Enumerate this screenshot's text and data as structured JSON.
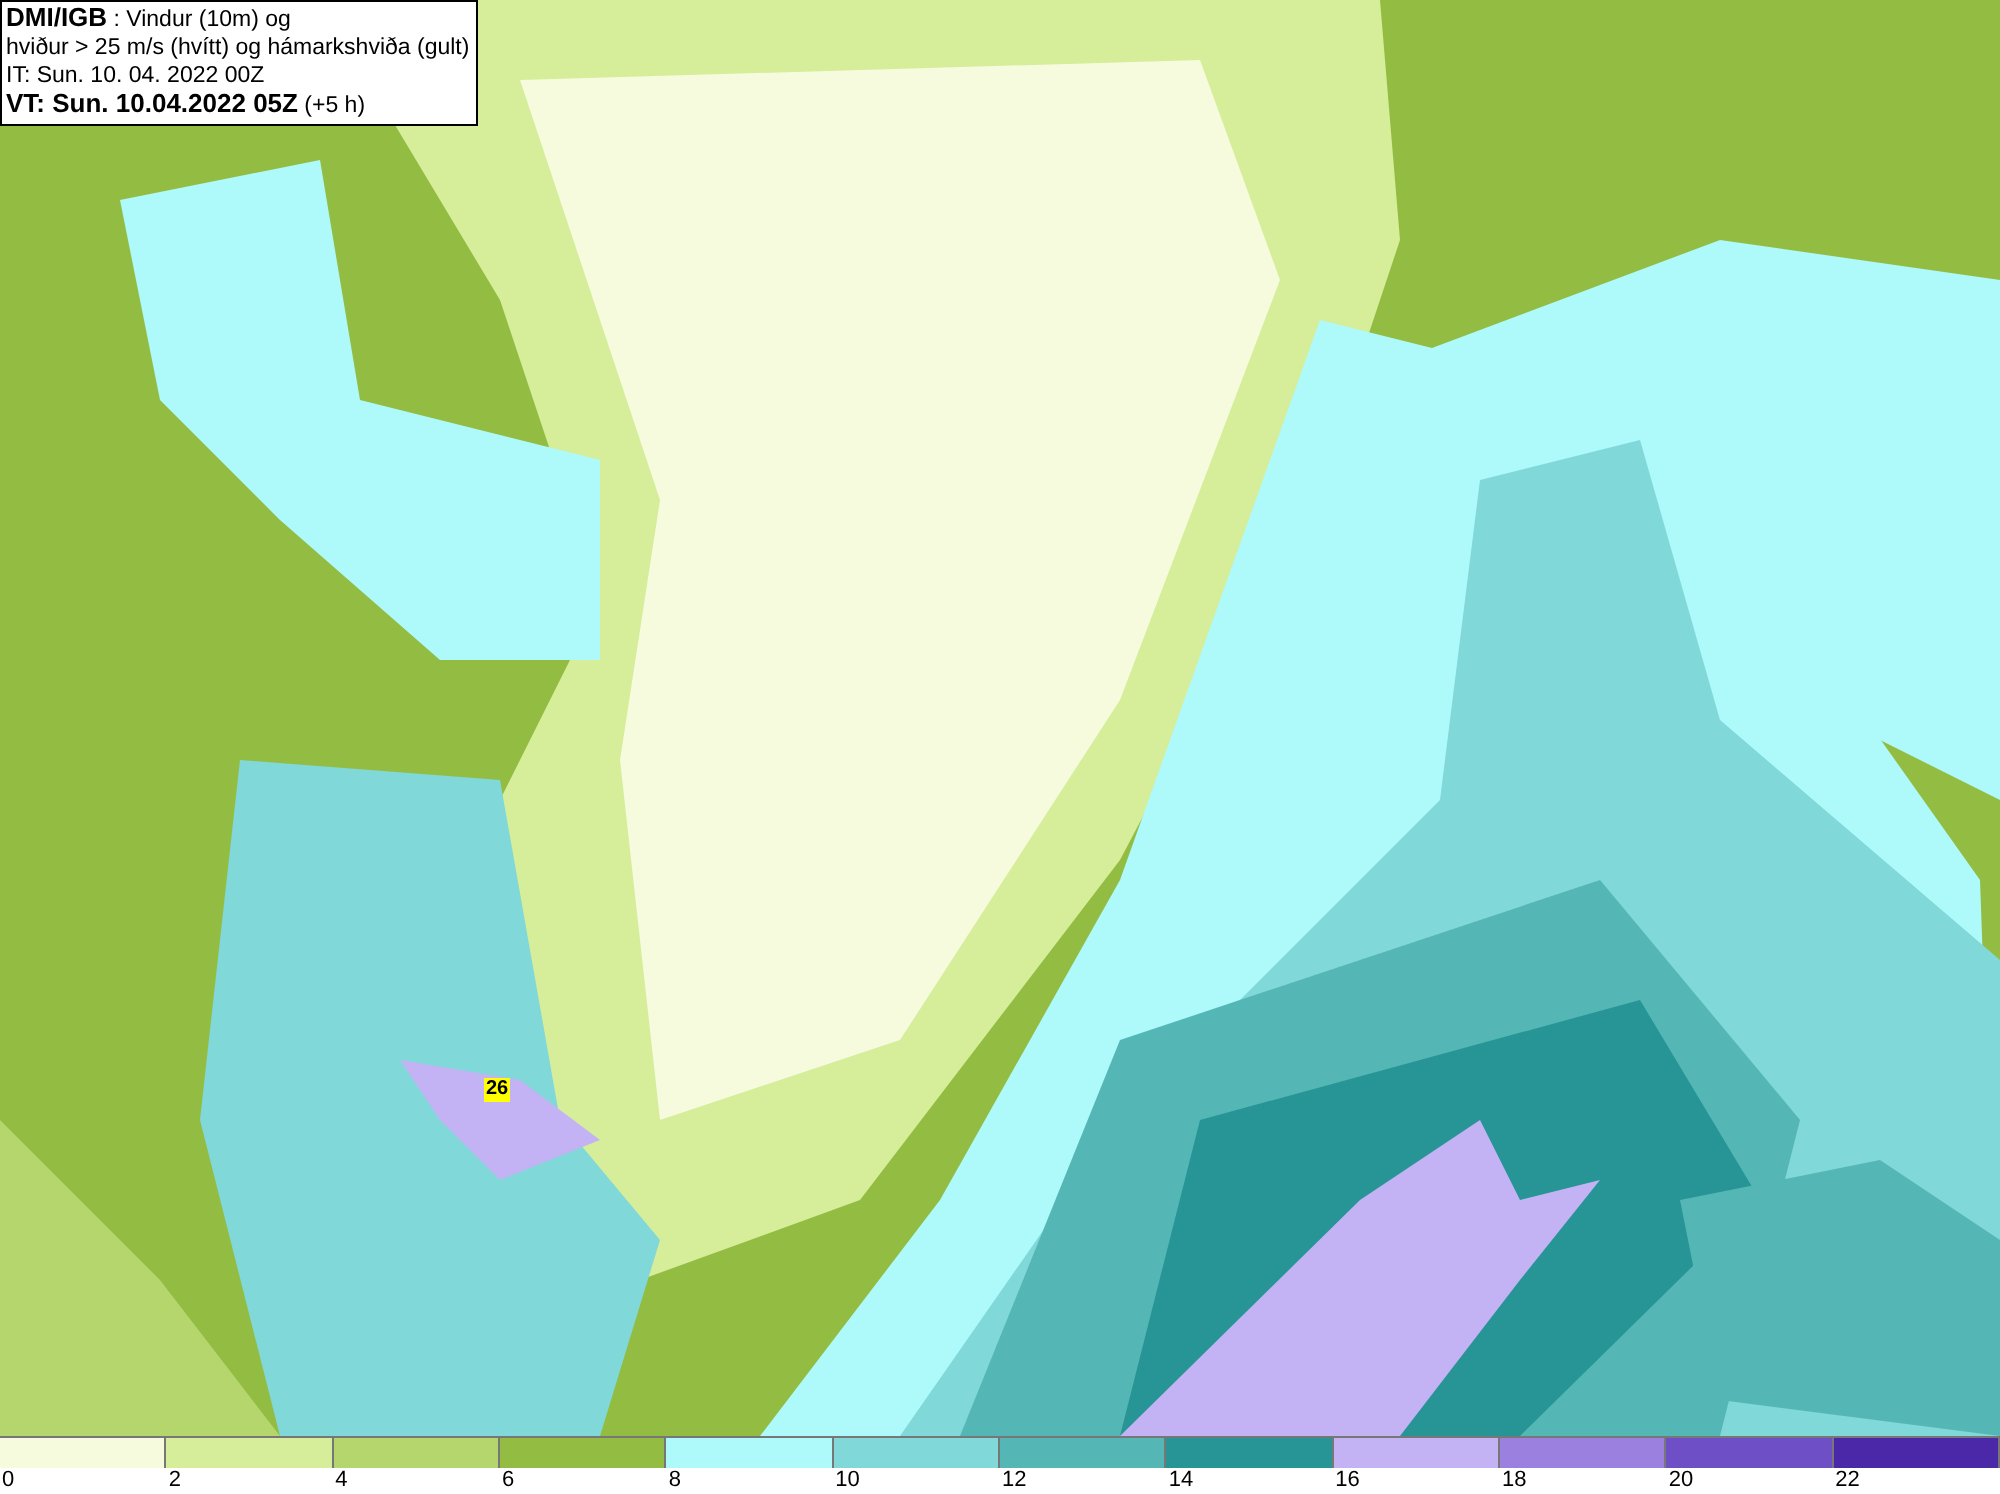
{
  "title_box": {
    "lines": [
      "**DMI/IGB** : Vindur (10m) og",
      "hviður > 25 m/s (hvítt) og hámarkshviða (gult)",
      "IT: Sun. 10. 04. 2022 00Z",
      "**VT: Sun. 10.04.2022 05Z** (+5 h)"
    ]
  },
  "map": {
    "gust_label": "26"
  },
  "legend": [
    {
      "color": "#f5fbdc",
      "label": "0"
    },
    {
      "color": "#d6ed9a",
      "label": "2"
    },
    {
      "color": "#b5d56d",
      "label": "4"
    },
    {
      "color": "#93bc43",
      "label": "6"
    },
    {
      "color": "#aefafa",
      "label": "8"
    },
    {
      "color": "#80d8d8",
      "label": "10"
    },
    {
      "color": "#55b6b6",
      "label": "12"
    },
    {
      "color": "#279595",
      "label": "14"
    },
    {
      "color": "#c3b2f4",
      "label": "16"
    },
    {
      "color": "#9b80e0",
      "label": "18"
    },
    {
      "color": "#6f4fc6",
      "label": "20"
    },
    {
      "color": "#4a28a8",
      "label": "22"
    }
  ]
}
